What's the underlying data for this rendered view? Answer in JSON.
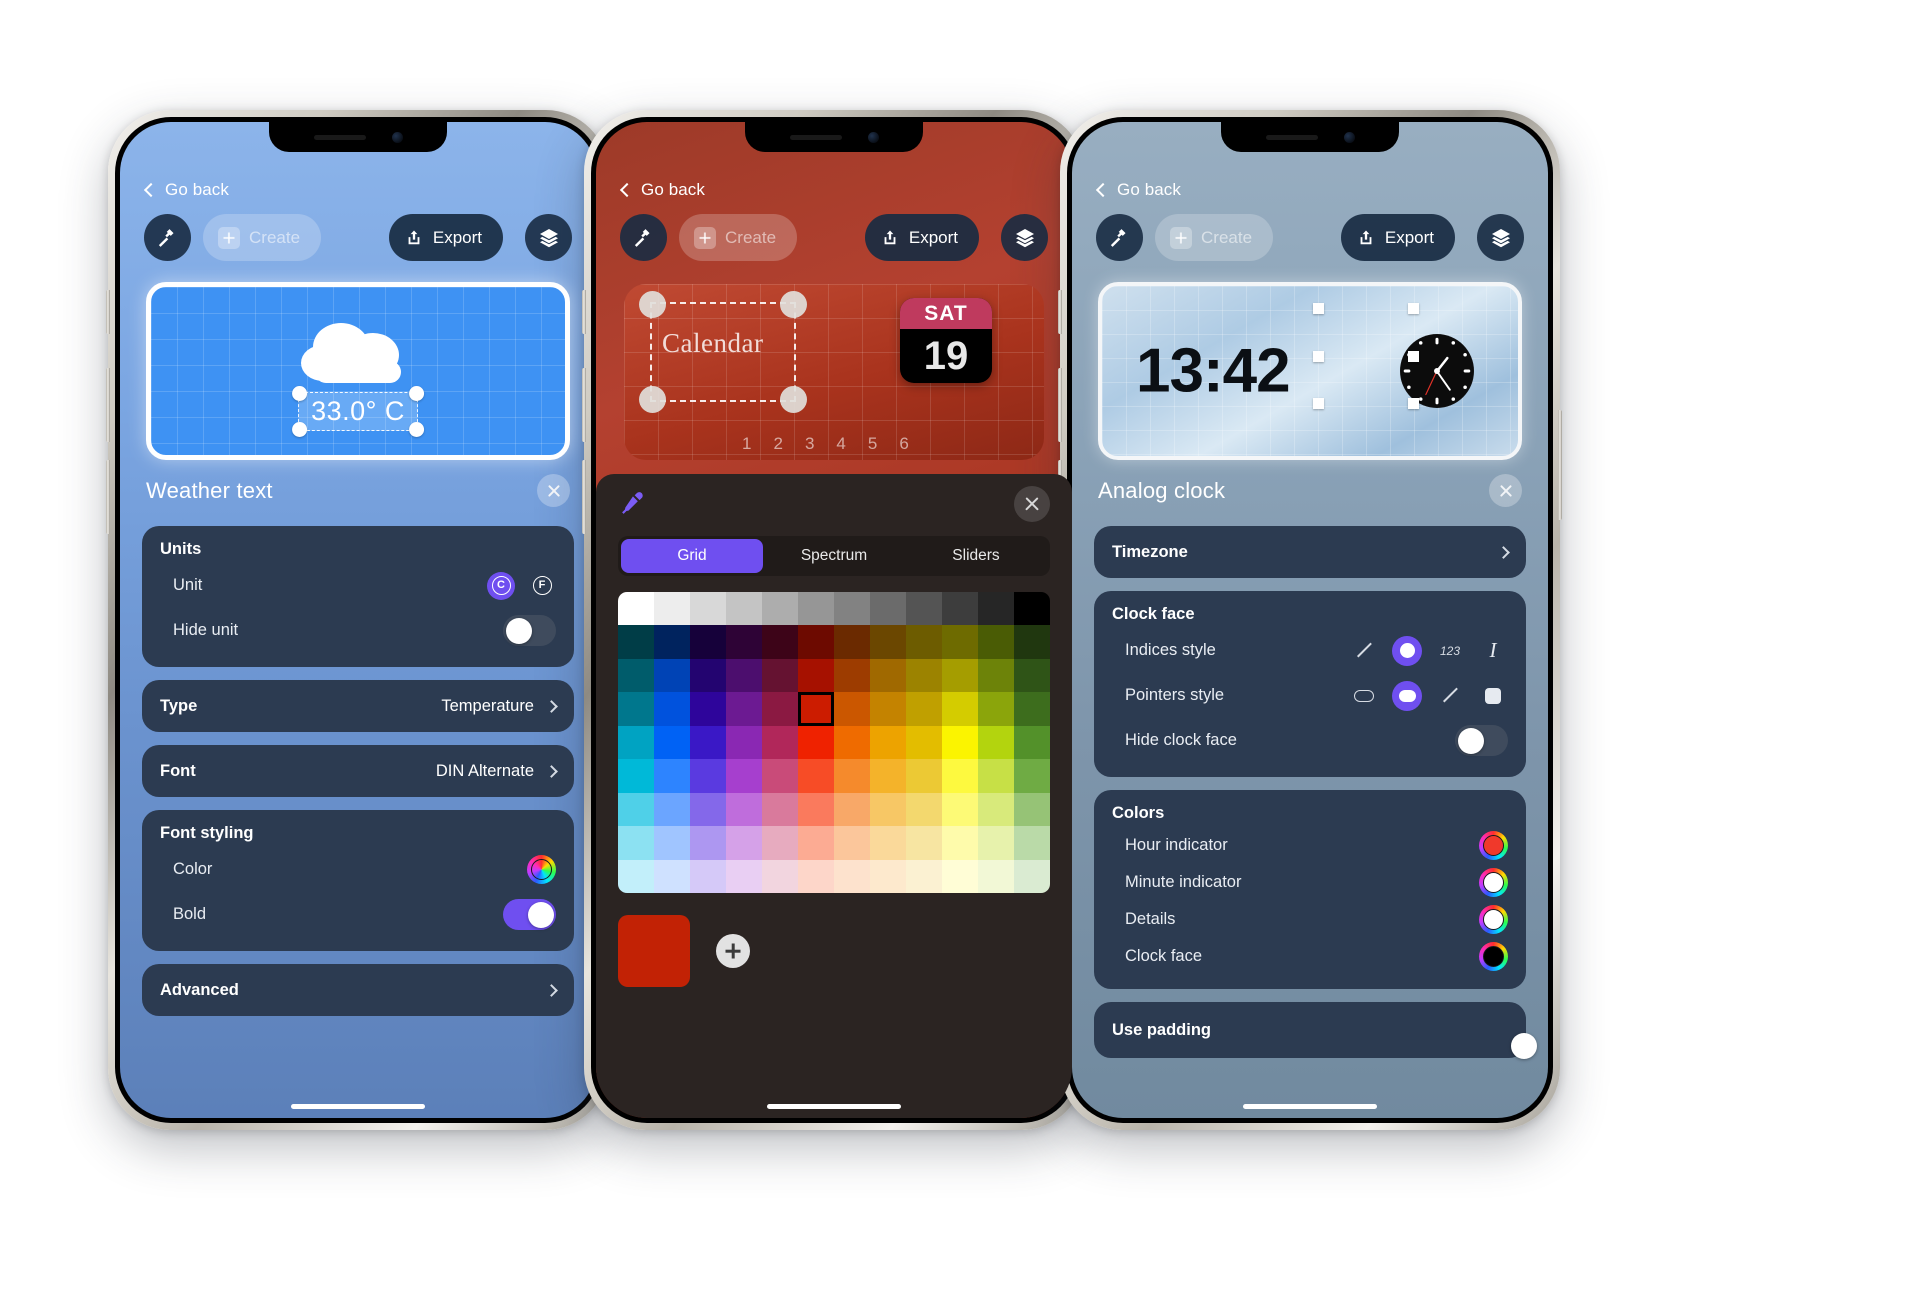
{
  "common": {
    "back_label": "Go back",
    "create_label": "Create",
    "export_label": "Export",
    "tool_icon": "hammer-icon",
    "export_icon": "share-upload-icon",
    "layers_icon": "layers-icon",
    "accent_purple": "#6f4ff0",
    "card_bg": "#2c3b51"
  },
  "phone1": {
    "screen_bg": "#7ba6e2",
    "canvas": {
      "background": "#3e92f3",
      "icon": "cloud-icon",
      "selected_text": "33.0° C"
    },
    "section_title": "Weather text",
    "units": {
      "title": "Units",
      "unit_label": "Unit",
      "unit_options": [
        "C",
        "F"
      ],
      "unit_selected": "C",
      "hide_unit_label": "Hide unit",
      "hide_unit_on": false
    },
    "type": {
      "label": "Type",
      "value": "Temperature"
    },
    "font": {
      "label": "Font",
      "value": "DIN Alternate"
    },
    "font_styling": {
      "title": "Font styling",
      "color_label": "Color",
      "color_value": "#ffffff",
      "bold_label": "Bold",
      "bold_on": true
    },
    "advanced": {
      "label": "Advanced"
    }
  },
  "phone2": {
    "screen_bg": "#a8331f",
    "canvas": {
      "widget_text": "Calendar",
      "cal_weekday": "SAT",
      "cal_day": "19",
      "ruler_numbers": [
        "1",
        "2",
        "3",
        "4",
        "5",
        "6"
      ]
    },
    "picker": {
      "eyedropper_icon": "eyedropper-icon",
      "close_icon": "close-icon",
      "tabs": [
        "Grid",
        "Spectrum",
        "Sliders"
      ],
      "active_tab": "Grid",
      "selected_color": "#c22205",
      "add_icon": "plus-icon",
      "grid_rows": [
        [
          "#ffffff",
          "#ededed",
          "#d8d8d8",
          "#c4c4c4",
          "#adadad",
          "#969696",
          "#828282",
          "#6b6b6b",
          "#545454",
          "#3d3d3d",
          "#262626",
          "#000000"
        ],
        [
          "#003d47",
          "#00235e",
          "#16013a",
          "#2e0336",
          "#3d0418",
          "#6d0a00",
          "#6b2a00",
          "#6b4700",
          "#6d5c00",
          "#6e6b00",
          "#4a5c05",
          "#20370f"
        ],
        [
          "#005c6b",
          "#0043b5",
          "#230470",
          "#4c0e6e",
          "#651231",
          "#a61100",
          "#9d3c00",
          "#a06900",
          "#9c8300",
          "#a59d00",
          "#6d8309",
          "#2f5417"
        ],
        [
          "#00778d",
          "#0052dd",
          "#2e059b",
          "#6c1a92",
          "#8b1942",
          "#cc1c00",
          "#cb5700",
          "#c48300",
          "#c0a000",
          "#d4cc00",
          "#8ba50b",
          "#3d6d1d"
        ],
        [
          "#00a3c2",
          "#0062f5",
          "#3a18c6",
          "#8a28b3",
          "#b1275a",
          "#ef2200",
          "#ef6b00",
          "#eda300",
          "#e3bd00",
          "#fbf400",
          "#b3d40e",
          "#53912a"
        ],
        [
          "#00b9d8",
          "#2d84ff",
          "#5a3ae0",
          "#a63fce",
          "#c94b79",
          "#f74c26",
          "#f58a2c",
          "#f4b32a",
          "#ecc934",
          "#fdf93f",
          "#c7e046",
          "#6fab44"
        ],
        [
          "#4fd0e8",
          "#6ba5ff",
          "#8468ea",
          "#bf6ddc",
          "#d97a9c",
          "#fa7a5d",
          "#f8a868",
          "#f7c765",
          "#f3d86e",
          "#fdfa76",
          "#d8ea7b",
          "#96c376"
        ],
        [
          "#8ce1f2",
          "#a0c5ff",
          "#ad97f1",
          "#d5a1e8",
          "#e7abbf",
          "#fcab93",
          "#fbc69b",
          "#fad99a",
          "#f7e5a2",
          "#fefbab",
          "#e7f2ac",
          "#badaa8"
        ],
        [
          "#c2effa",
          "#cfe1ff",
          "#d5c9f8",
          "#e9cff3",
          "#f2d5df",
          "#fdd6c9",
          "#fde2cd",
          "#fde9cd",
          "#fbf1d2",
          "#fffdd6",
          "#f2f8d6",
          "#daebd2"
        ]
      ],
      "grid_selected": {
        "row": 3,
        "col": 5
      }
    }
  },
  "phone3": {
    "screen_bg": "#8ba3b8",
    "canvas": {
      "time_text": "13:42",
      "dial_icon": "analog-clock-icon"
    },
    "section_title": "Analog clock",
    "timezone": {
      "label": "Timezone"
    },
    "clock_face": {
      "title": "Clock face",
      "indices_label": "Indices style",
      "indices_options": [
        "line",
        "circle",
        "123",
        "italic"
      ],
      "indices_selected": "circle",
      "indices_numeric_label": "123",
      "pointers_label": "Pointers style",
      "pointers_options": [
        "rounded-outline",
        "oval",
        "line",
        "square"
      ],
      "pointers_selected": "oval",
      "hide_label": "Hide clock face",
      "hide_on": false
    },
    "colors": {
      "title": "Colors",
      "items": [
        {
          "label": "Hour indicator",
          "value": "#f0392b"
        },
        {
          "label": "Minute indicator",
          "value": "#ffffff"
        },
        {
          "label": "Details",
          "value": "#ffffff"
        },
        {
          "label": "Clock face",
          "value": "#000000"
        }
      ]
    },
    "use_padding": {
      "label": "Use padding",
      "on": false
    }
  }
}
